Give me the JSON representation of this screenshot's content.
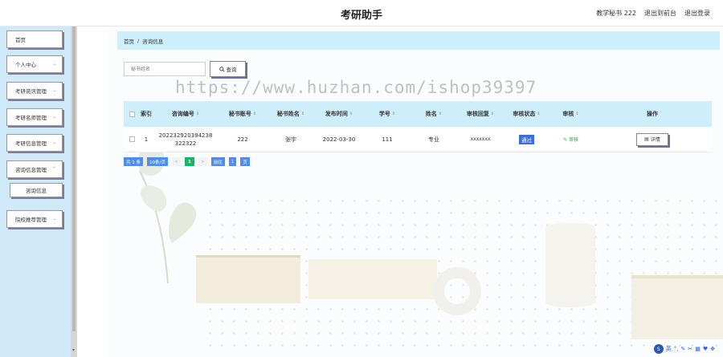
{
  "header": {
    "title": "考研助手",
    "links": [
      "教学秘书 222",
      "退出到前台",
      "退出登录"
    ]
  },
  "sidebar": {
    "items": [
      {
        "label": "首页",
        "has_chevron": false
      },
      {
        "label": "个人中心",
        "has_chevron": true
      },
      {
        "label": "考研资讯管理",
        "has_chevron": true
      },
      {
        "label": "考研名师管理",
        "has_chevron": true
      },
      {
        "label": "考研信息管理",
        "has_chevron": true
      },
      {
        "label": "咨询信息管理",
        "has_chevron": true
      },
      {
        "label": "院校推荐管理",
        "has_chevron": true
      }
    ],
    "sub_item": "咨询信息"
  },
  "breadcrumb": {
    "home": "首页",
    "separator": "/",
    "current": "咨询信息"
  },
  "search": {
    "placeholder": "秘书姓名",
    "button_label": "查询"
  },
  "watermark": "https://www.huzhan.com/ishop39397",
  "table": {
    "headers": [
      "索引",
      "咨询编号",
      "秘书账号",
      "秘书姓名",
      "发布时间",
      "学号",
      "姓名",
      "审核回复",
      "审核状态",
      "审核",
      "操作"
    ],
    "rows": [
      {
        "index": "1",
        "consult_no": "202232920394238322322",
        "secretary_account": "222",
        "secretary_name": "张宇",
        "publish_time": "2022-03-30",
        "student_no": "111",
        "name": "专业",
        "audit_reply": "xxxxxxx",
        "audit_status": "通过",
        "audit_action": "审核",
        "detail_label": "详情"
      }
    ]
  },
  "pagination": {
    "total": "共 1 条",
    "page_size": "10条/页",
    "prev": "<",
    "current": "1",
    "next": ">",
    "goto_label": "前往",
    "goto_value": "1",
    "page_suffix": "页"
  },
  "bottom_tools": {
    "ime": "英"
  },
  "colors": {
    "sidebar_bg": "#cfe9f8",
    "header_row_bg": "#cfeefb",
    "status_tag": "#3b6fd6",
    "pager_current": "#18b566",
    "audit_link": "#2aa34a"
  }
}
